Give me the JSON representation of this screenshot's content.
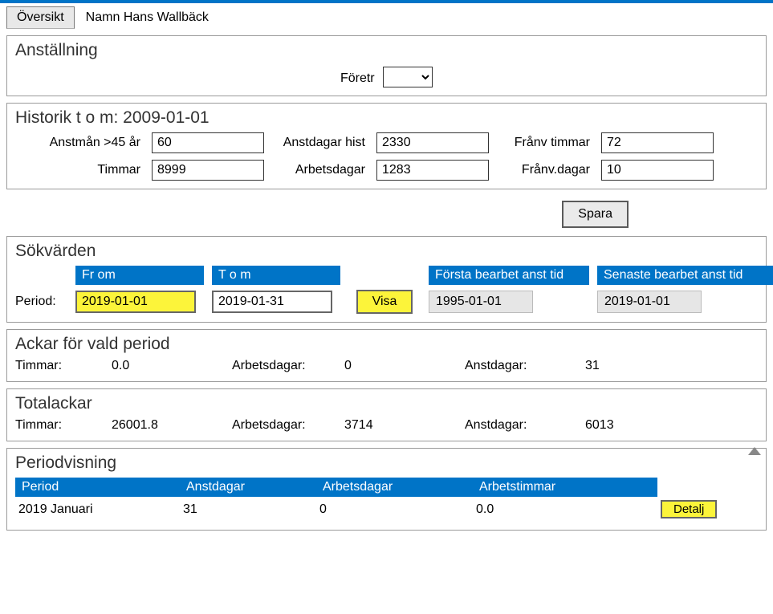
{
  "tabs": {
    "active": "Översikt"
  },
  "namn": {
    "label": "Namn",
    "value": "Hans Wallbäck"
  },
  "anstallning": {
    "title": "Anställning",
    "foretr_label": "Företr"
  },
  "historik": {
    "title": "Historik t o m: 2009-01-01",
    "fields": {
      "anstman45_label": "Anstmån >45 år",
      "anstman45": "60",
      "anstdagar_hist_label": "Anstdagar hist",
      "anstdagar_hist": "2330",
      "franv_timmar_label": "Frånv timmar",
      "franv_timmar": "72",
      "timmar_label": "Timmar",
      "timmar": "8999",
      "arbetsdagar_label": "Arbetsdagar",
      "arbetsdagar": "1283",
      "franv_dagar_label": "Frånv.dagar",
      "franv_dagar": "10"
    }
  },
  "spara_label": "Spara",
  "sok": {
    "title": "Sökvärden",
    "headers": {
      "frod": "Fr om",
      "tom": "T o m",
      "forsta": "Första bearbet anst tid",
      "senaste": "Senaste bearbet anst tid"
    },
    "period_label": "Period:",
    "from": "2019-01-01",
    "to": "2019-01-31",
    "visa_label": "Visa",
    "forsta_val": "1995-01-01",
    "senaste_val": "2019-01-01"
  },
  "ackar": {
    "title": "Ackar för vald period",
    "timmar_label": "Timmar:",
    "timmar": "0.0",
    "arbetsdagar_label": "Arbetsdagar:",
    "arbetsdagar": "0",
    "anstdagar_label": "Anstdagar:",
    "anstdagar": "31"
  },
  "total": {
    "title": "Totalackar",
    "timmar_label": "Timmar:",
    "timmar": "26001.8",
    "arbetsdagar_label": "Arbetsdagar:",
    "arbetsdagar": "3714",
    "anstdagar_label": "Anstdagar:",
    "anstdagar": "6013"
  },
  "periodvisning": {
    "title": "Periodvisning",
    "headers": {
      "period": "Period",
      "anstdagar": "Anstdagar",
      "arbetsdagar": "Arbetsdagar",
      "arbetstimmar": "Arbetstimmar"
    },
    "rows": [
      {
        "period": "2019 Januari",
        "anstdagar": "31",
        "arbetsdagar": "0",
        "arbetstimmar": "0.0"
      }
    ],
    "detalj_label": "Detalj"
  }
}
